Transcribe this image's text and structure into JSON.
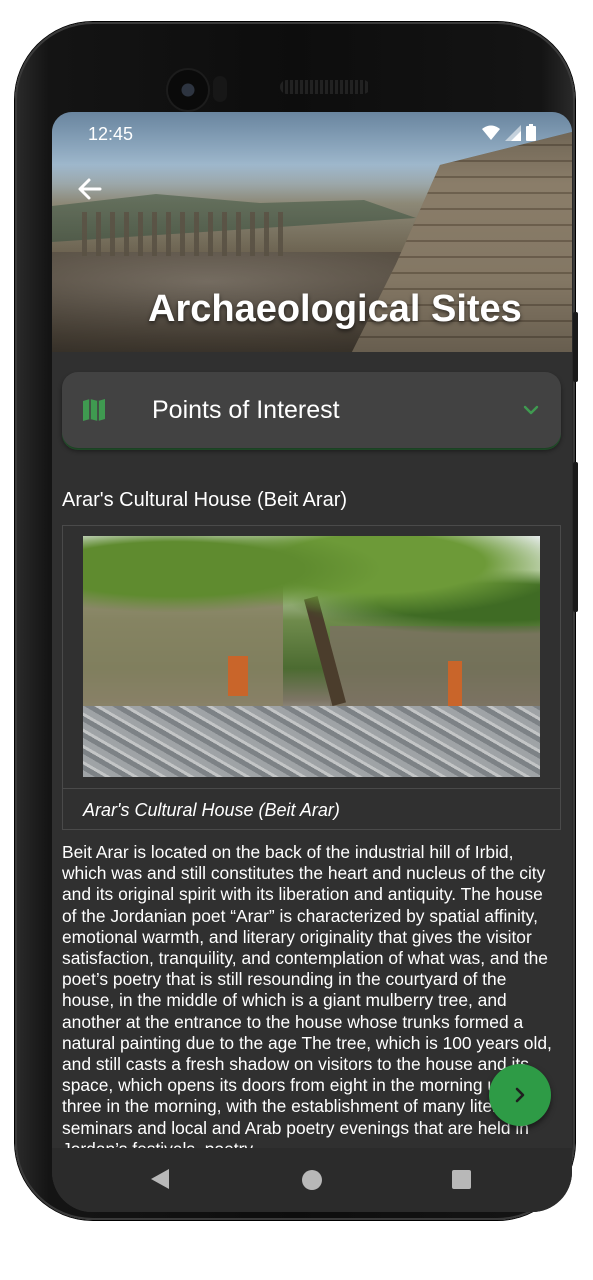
{
  "status_bar": {
    "time": "12:45"
  },
  "header": {
    "title": "Archaeological Sites"
  },
  "dropdown": {
    "label": "Points of Interest"
  },
  "content": {
    "section_title": "Arar's Cultural House (Beit Arar)",
    "caption": "Arar's Cultural House (Beit Arar)",
    "body": "Beit Arar is located on the back of the industrial hill of Irbid, which was and still constitutes the heart and nucleus of the city and its original spirit with its liberation and antiquity. The house of the Jordanian poet “Arar” is characterized by spatial affinity, emotional warmth, and literary originality that gives the visitor satisfaction, tranquility, and contemplation of what was, and the poet’s poetry that is still resounding in the courtyard of the house, in the middle of which is a giant mulberry tree, and another at the entrance to the house whose trunks formed a natural painting due to the age The tree, which is 100 years old, and still casts a fresh shadow on visitors to the house and its space, which opens its doors from eight in the morning until three in the morning, with the establishment of many literary seminars and local and Arab poetry evenings that are held in Jordan’s festivals, poetry"
  },
  "colors": {
    "accent": "#2e9b46",
    "background": "#303030",
    "card": "#424242"
  },
  "icons": {
    "back": "arrow-left-icon",
    "map": "map-icon",
    "chevron": "chevron-down-icon",
    "fab": "chevron-right-icon",
    "nav_back": "triangle-back-icon",
    "nav_home": "circle-home-icon",
    "nav_recent": "square-recent-icon"
  }
}
